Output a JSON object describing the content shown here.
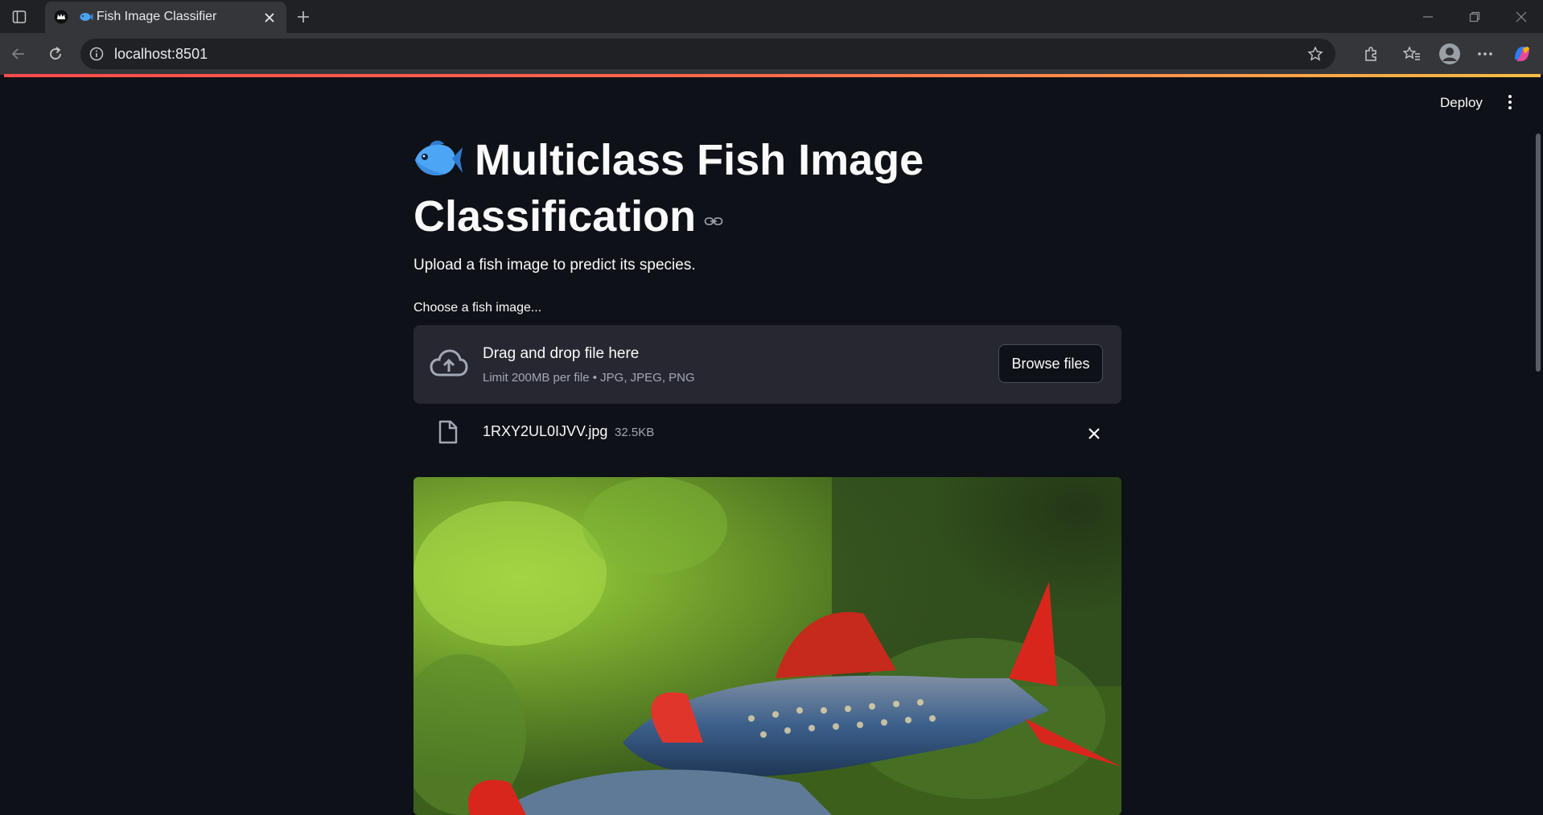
{
  "browser": {
    "tab_title": "Fish Image Classifier",
    "url": "localhost:8501",
    "icons": [
      "sidebar-toggle-icon",
      "app-crown-icon",
      "fish-favicon-icon",
      "close-icon",
      "plus-icon",
      "minimize-icon",
      "restore-icon",
      "window-close-icon",
      "back-arrow-icon",
      "reload-icon",
      "info-icon",
      "star-icon",
      "extensions-icon",
      "favorites-icon",
      "profile-icon",
      "more-icon",
      "copilot-icon"
    ]
  },
  "app": {
    "deploy_label": "Deploy",
    "title": "Multiclass Fish Image Classification",
    "title_emoji": "fish-emoji",
    "subtitle": "Upload a fish image to predict its species.",
    "uploader": {
      "label": "Choose a fish image...",
      "drop_title": "Drag and drop file here",
      "limit_text": "Limit 200MB per file • JPG, JPEG, PNG",
      "browse_label": "Browse files"
    },
    "uploaded_file": {
      "name": "1RXY2UL0IJVV.jpg",
      "size": "32.5KB"
    }
  },
  "colors": {
    "background": "#0e1117",
    "dropzone": "#262730",
    "accent_gradient_start": "#ff4b4b",
    "accent_gradient_end": "#ffbd45",
    "text": "#fafafa",
    "muted_text": "#a3a8b4"
  }
}
